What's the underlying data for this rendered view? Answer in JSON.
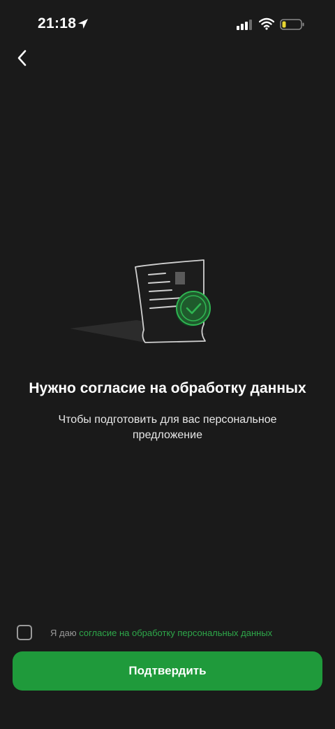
{
  "status_bar": {
    "time": "21:18"
  },
  "main": {
    "title": "Нужно согласие на обработку данных",
    "subtitle": "Чтобы подготовить для вас персональное предложение"
  },
  "consent": {
    "prefix": "Я даю ",
    "link_text": "согласие на обработку персональных данных",
    "checked": false
  },
  "footer": {
    "confirm_label": "Подтвердить"
  },
  "colors": {
    "background": "#1a1a1a",
    "accent_green": "#1f9a3b",
    "link_green": "#2ea84a"
  },
  "icons": [
    "location-arrow-icon",
    "signal-icon",
    "wifi-icon",
    "battery-icon",
    "back-chevron-icon",
    "document-check-icon"
  ]
}
